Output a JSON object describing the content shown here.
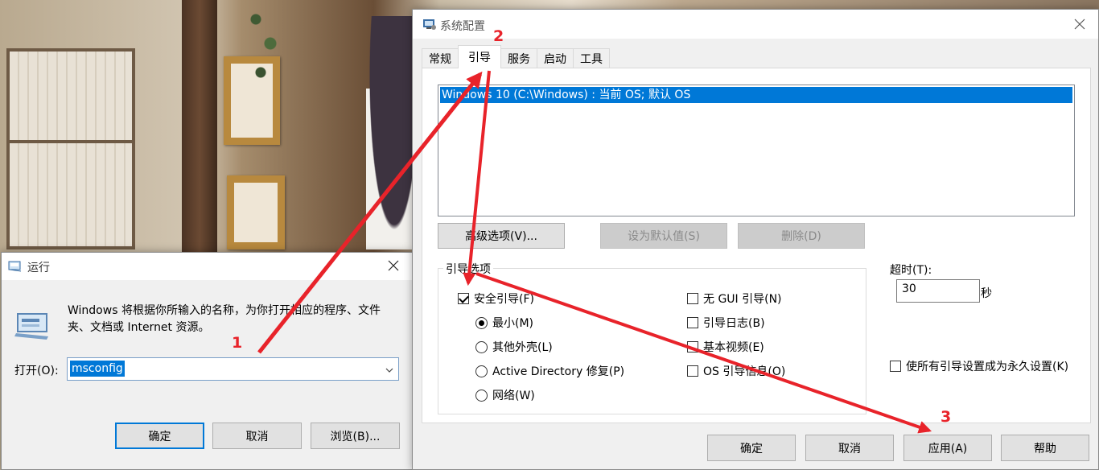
{
  "colors": {
    "accent": "#0078d7",
    "annotation": "#e8232a"
  },
  "run_dialog": {
    "title": "运行",
    "title_icon": "run-icon",
    "description": "Windows 将根据你所输入的名称，为你打开相应的程序、文件夹、文档或 Internet 资源。",
    "open_label": "打开(O):",
    "open_value": "msconfig",
    "buttons": {
      "ok": "确定",
      "cancel": "取消",
      "browse": "浏览(B)..."
    }
  },
  "msconfig": {
    "title": "系统配置",
    "tabs": [
      "常规",
      "引导",
      "服务",
      "启动",
      "工具"
    ],
    "active_tab": "引导",
    "boot_entries": [
      "Windows 10 (C:\\Windows) : 当前 OS; 默认 OS"
    ],
    "entry_buttons": {
      "advanced": "高级选项(V)...",
      "set_default": "设为默认值(S)",
      "delete": "删除(D)"
    },
    "boot_options": {
      "title": "引导选项",
      "safe_boot": {
        "label": "安全引导(F)",
        "checked": true
      },
      "radios": [
        {
          "label": "最小(M)",
          "selected": true
        },
        {
          "label": "其他外壳(L)",
          "selected": false
        },
        {
          "label": "Active Directory 修复(P)",
          "selected": false
        },
        {
          "label": "网络(W)",
          "selected": false
        }
      ],
      "right_checks": [
        {
          "label": "无 GUI 引导(N)",
          "checked": false
        },
        {
          "label": "引导日志(B)",
          "checked": false
        },
        {
          "label": "基本视频(E)",
          "checked": false
        },
        {
          "label": "OS 引导信息(O)",
          "checked": false
        }
      ]
    },
    "timeout": {
      "label": "超时(T):",
      "value": "30",
      "unit": "秒"
    },
    "permanent": {
      "label": "使所有引导设置成为永久设置(K)",
      "checked": false
    },
    "footer": {
      "ok": "确定",
      "cancel": "取消",
      "apply": "应用(A)",
      "help": "帮助"
    }
  },
  "annotations": {
    "step1": "1",
    "step2": "2",
    "step3": "3"
  }
}
